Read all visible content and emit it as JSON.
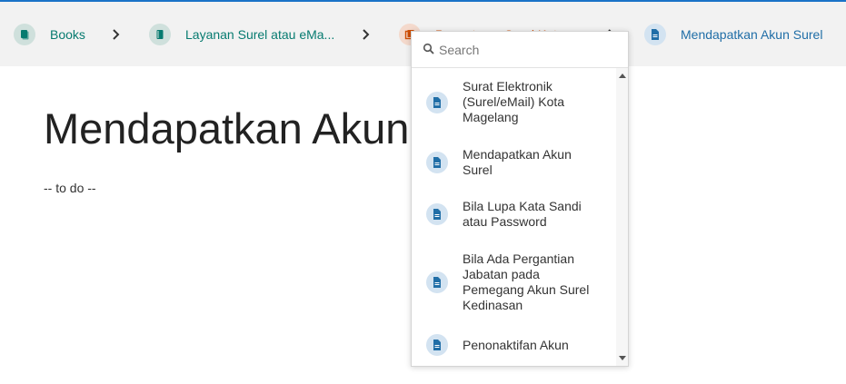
{
  "colors": {
    "accent": "#1a73c8",
    "book": "#077b70",
    "chapter": "#cf4d03",
    "page": "#206ea7"
  },
  "breadcrumb": {
    "items": [
      {
        "label": "Books",
        "icon": "books-icon",
        "type": "book"
      },
      {
        "label": "Layanan Surel atau eMa...",
        "icon": "book-icon",
        "type": "book"
      },
      {
        "label": "Pengaturan Surel Kota",
        "icon": "chapter-icon",
        "type": "chapter"
      },
      {
        "label": "Mendapatkan Akun Surel",
        "icon": "page-icon",
        "type": "page"
      }
    ],
    "separator_icon": "chevron-right-icon"
  },
  "page": {
    "title": "Mendapatkan Akun Surel",
    "body": "-- to do --"
  },
  "dropdown": {
    "search_placeholder": "Search",
    "search_value": "",
    "items": [
      {
        "label": "Surat Elektronik (Surel/eMail) Kota Magelang",
        "icon": "page-icon"
      },
      {
        "label": "Mendapatkan Akun Surel",
        "icon": "page-icon"
      },
      {
        "label": "Bila Lupa Kata Sandi atau Password",
        "icon": "page-icon"
      },
      {
        "label": "Bila Ada Pergantian Jabatan pada Pemegang Akun Surel Kedinasan",
        "icon": "page-icon"
      },
      {
        "label": "Penonaktifan Akun",
        "icon": "page-icon"
      }
    ]
  }
}
